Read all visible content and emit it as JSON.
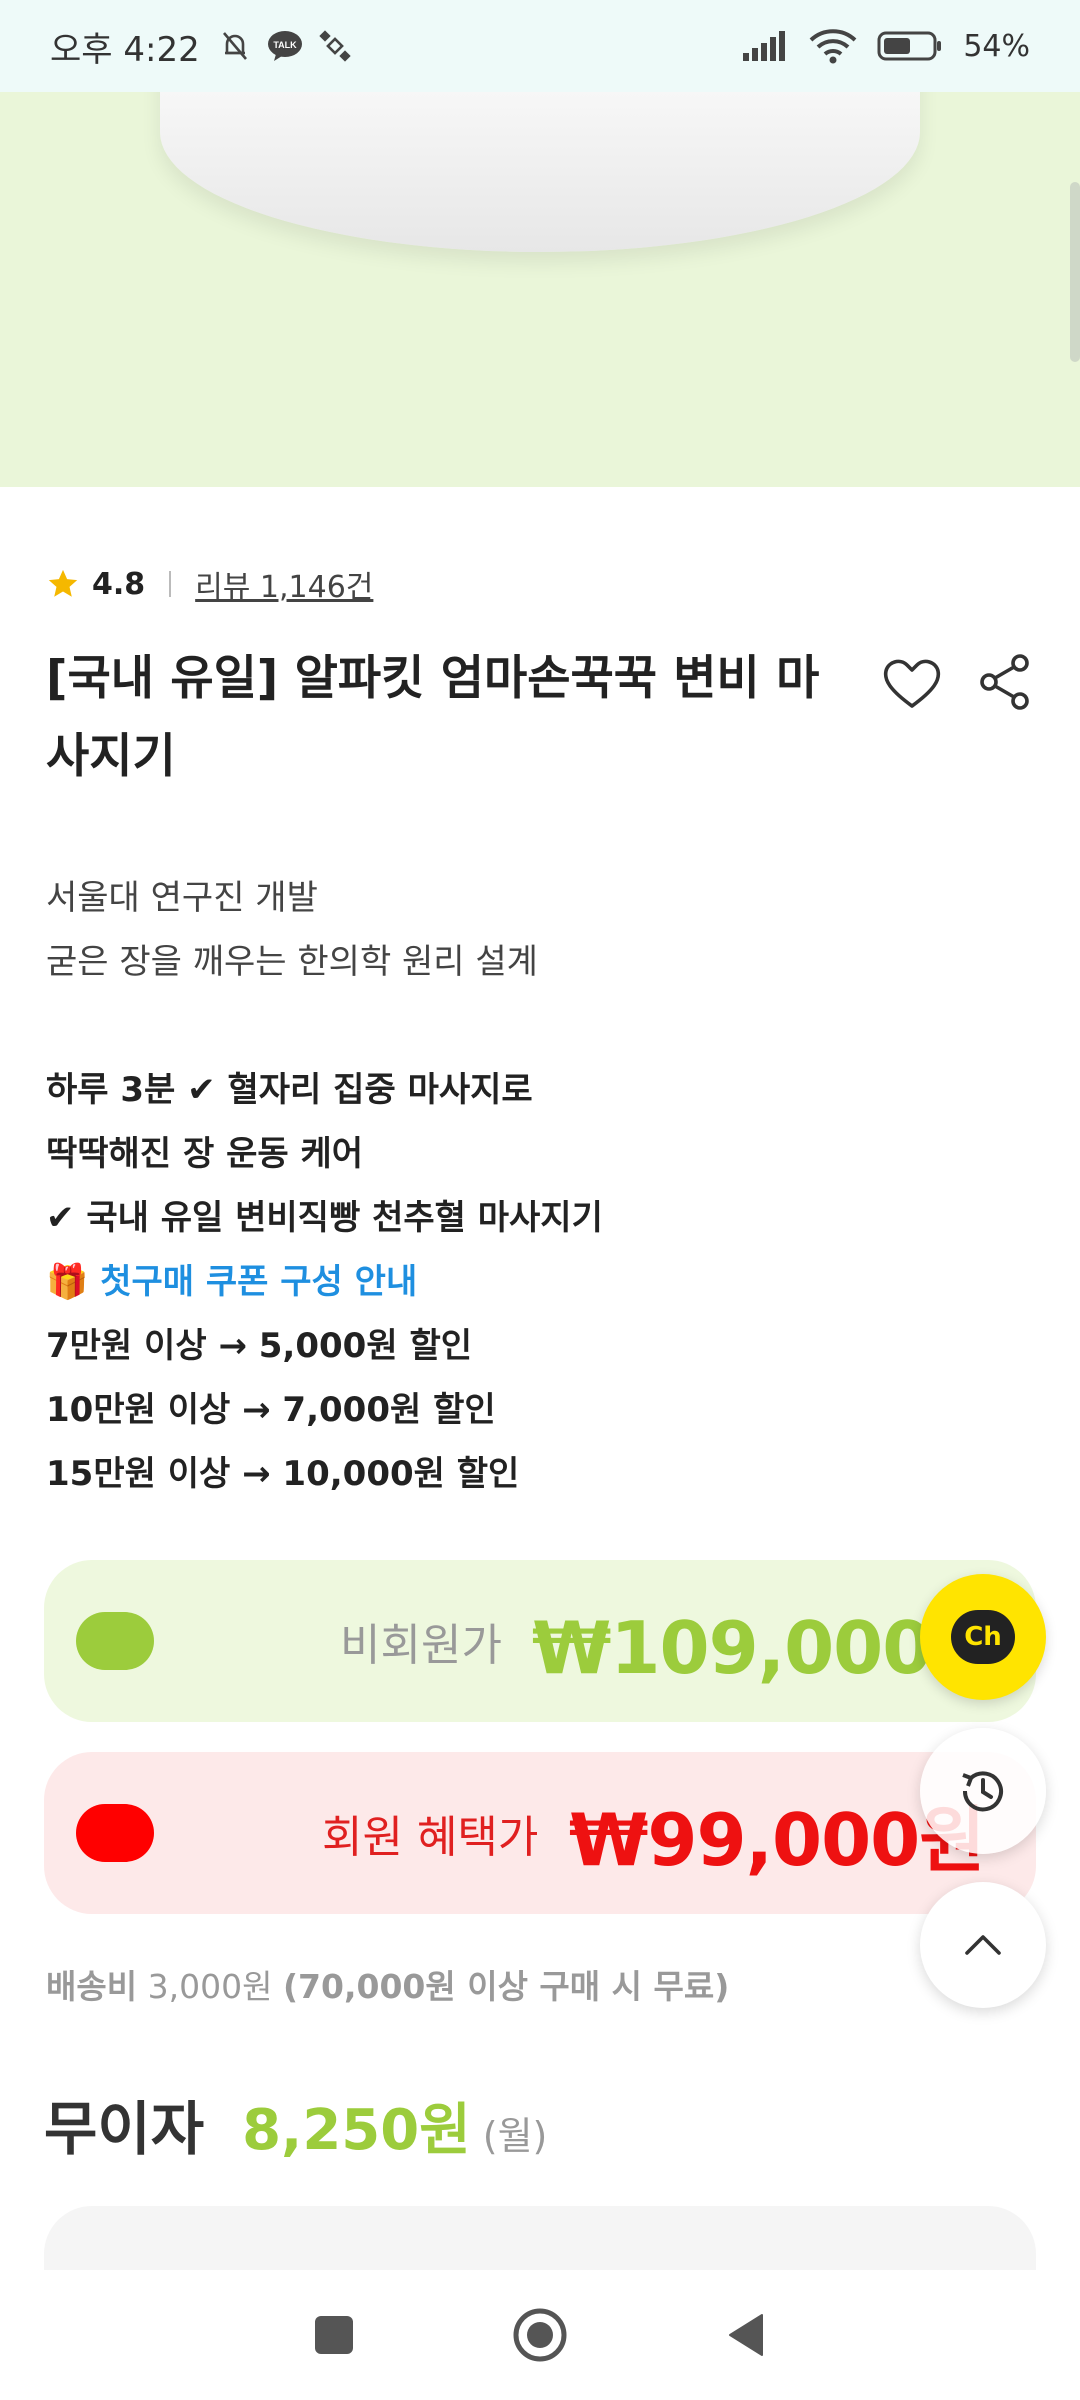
{
  "status_bar": {
    "time": "오후 4:22",
    "battery": "54%",
    "talk_badge": "TALK"
  },
  "product": {
    "rating": "4.8",
    "review_link": "리뷰 1,146건",
    "title_line1": "[국내 유일] 알파킷 엄마손꾹꾹 변비 마",
    "title_line2": "사지기"
  },
  "description": {
    "line1": "서울대 연구진 개발",
    "line2": "굳은 장을 깨우는 한의학 원리 설계",
    "line3": "하루 3분 ✔ 혈자리 집중 마사지로",
    "line4": "딱딱해진 장 운동 케어",
    "line5": "✔ 국내 유일 변비직빵 천추혈 마사지기",
    "line6_icon": "🎁",
    "line6": "첫구매 쿠폰 구성 안내",
    "line7": "7만원 이상 → 5,000원 할인",
    "line8": "10만원 이상 → 7,000원 할인",
    "line9": "15만원 이상 → 10,000원 할인"
  },
  "prices": {
    "nonmember_label": "비회원가",
    "nonmember_price": "₩109,000원",
    "member_label": "회원 혜택가",
    "member_price": "₩99,000원"
  },
  "floating": {
    "chat_label": "Ch"
  },
  "shipping": {
    "label": "배송비",
    "fee": "3,000원",
    "condition": "(70,000원 이상 구매 시 무료)"
  },
  "installment": {
    "label": "무이자",
    "amount": "8,250원",
    "unit": "(월)"
  },
  "colors": {
    "accent_green": "#9ccc3c",
    "member_red": "#ee1111",
    "coupon_blue": "#1e8fe0",
    "channel_yellow": "#ffe400"
  }
}
